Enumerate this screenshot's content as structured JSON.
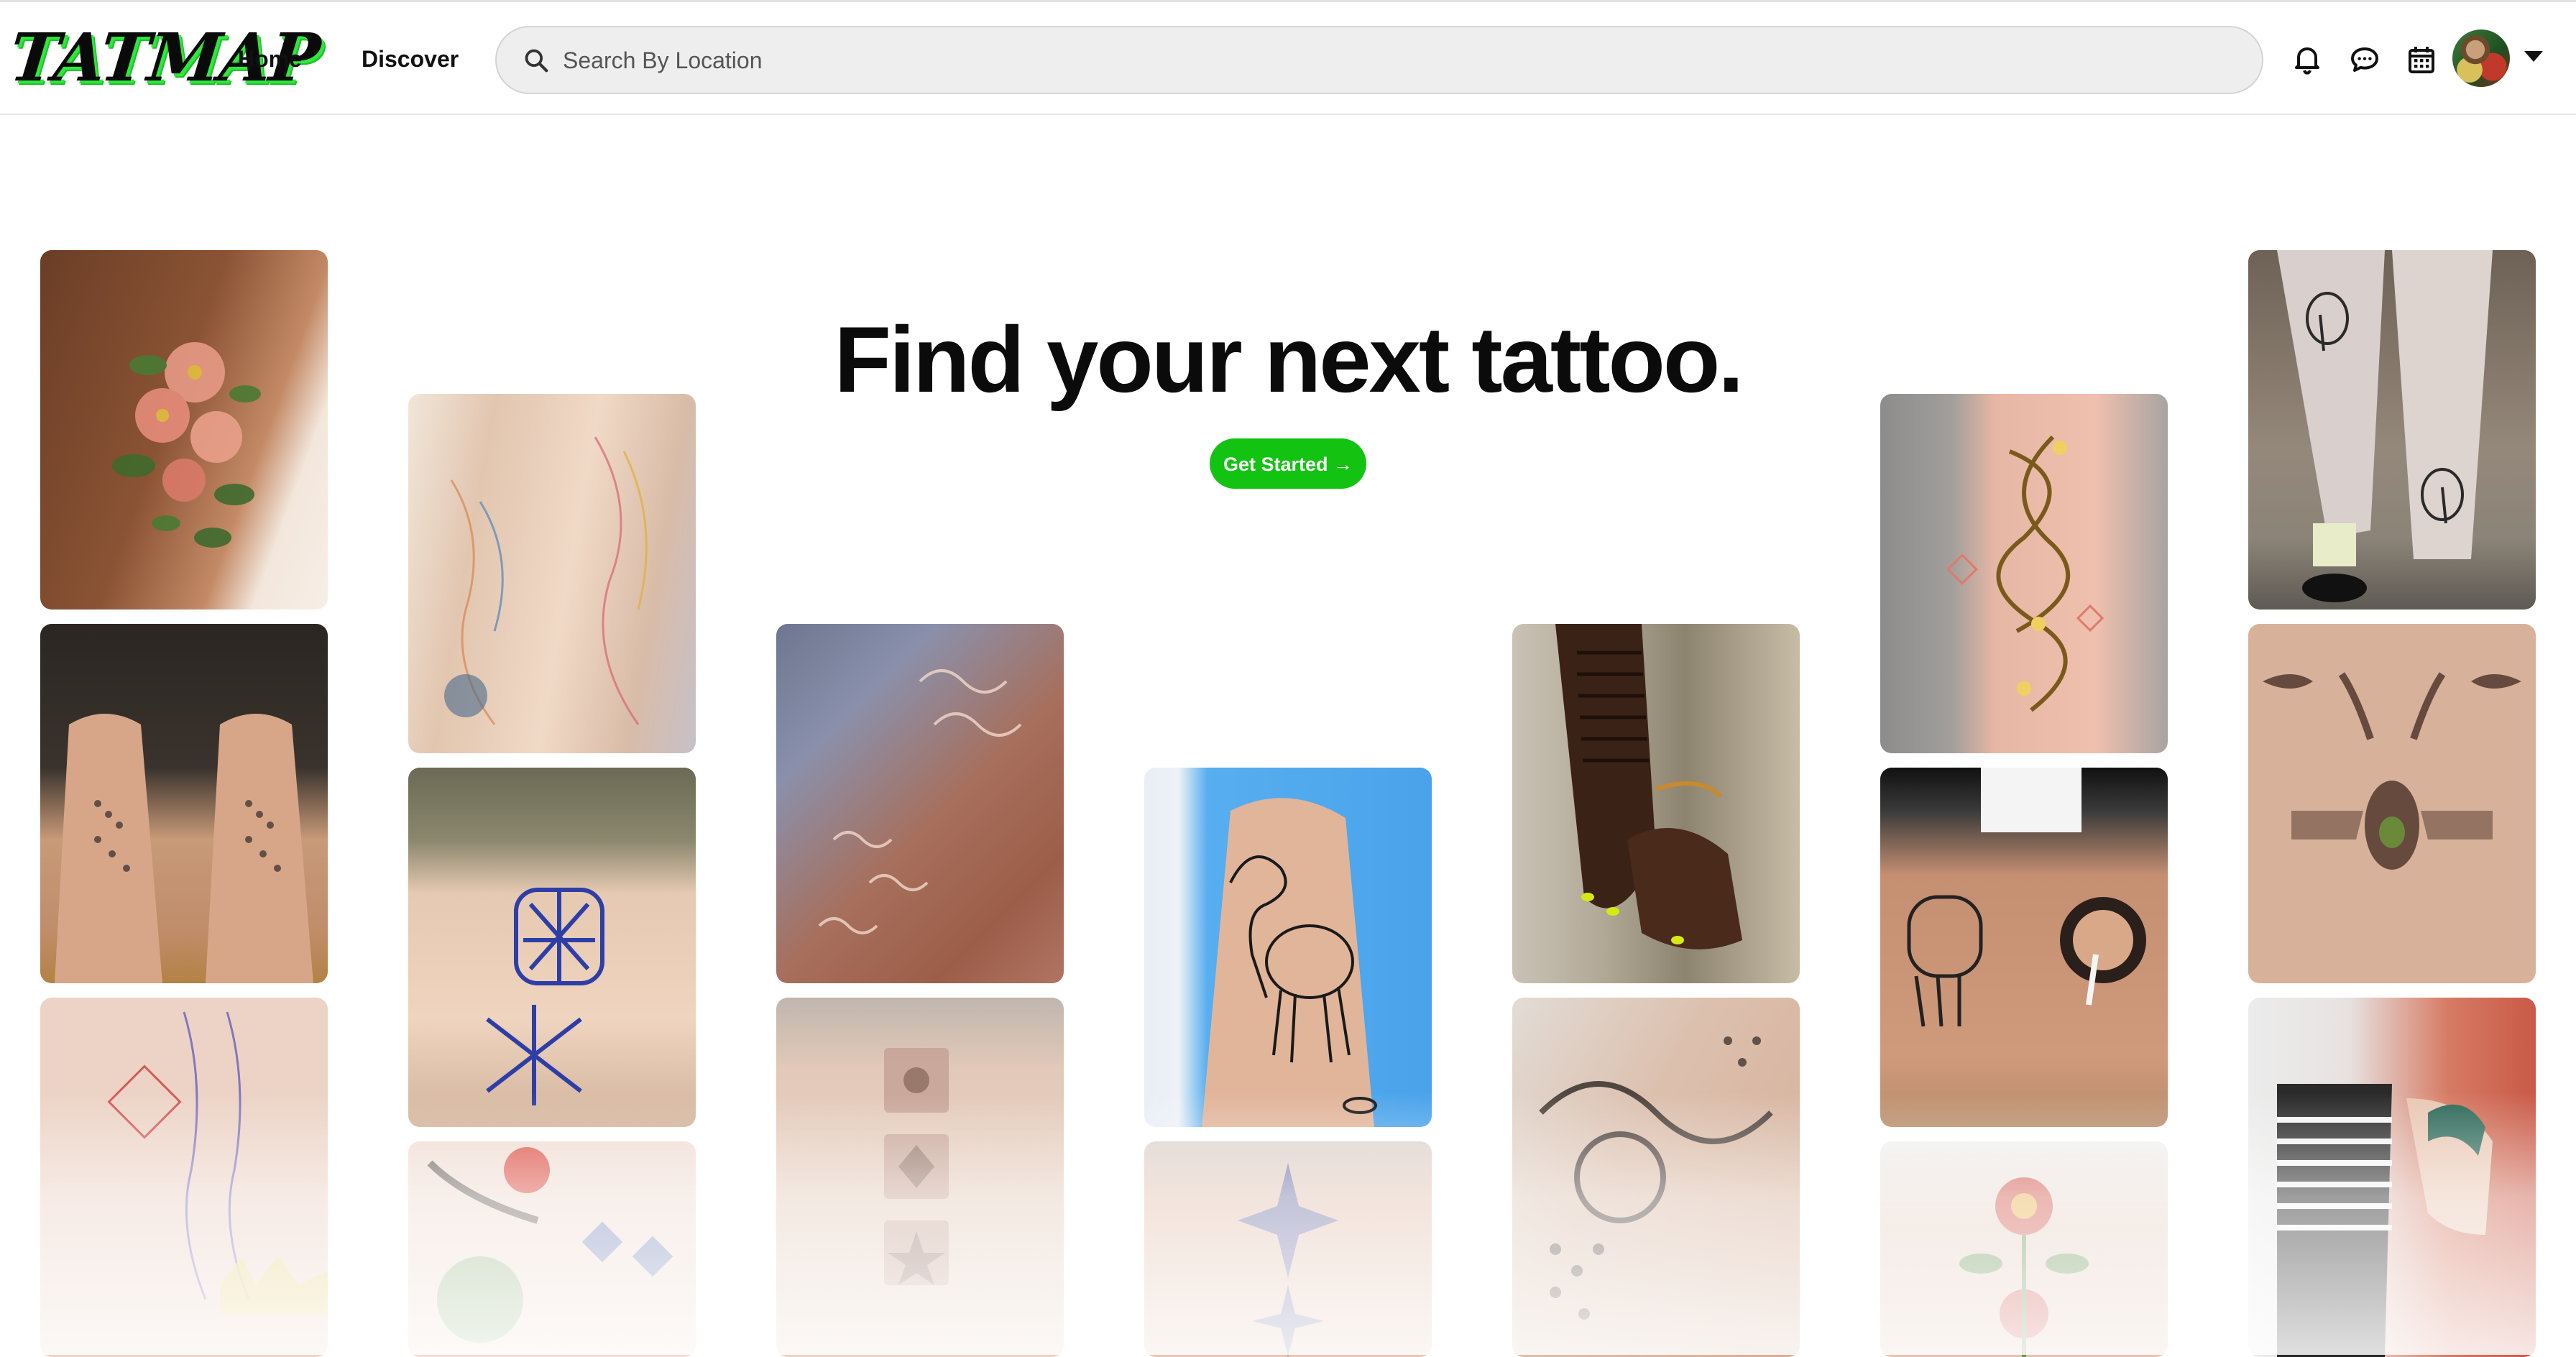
{
  "header": {
    "logo_text": "TATMAP",
    "nav": [
      {
        "label": "Home"
      },
      {
        "label": "Discover"
      }
    ],
    "search": {
      "placeholder": "Search By Location",
      "value": ""
    },
    "icons": [
      "bell-icon",
      "chat-icon",
      "calendar-icon"
    ]
  },
  "hero": {
    "headline": "Find your next tattoo.",
    "cta_label": "Get Started →"
  },
  "gallery": {
    "tile_count": 23,
    "colors": {
      "skin_dark": "#8b5a3c",
      "skin_light": "#e8c2a8",
      "blue_bg": "#57aef0",
      "accent_green": "#12c312"
    }
  }
}
